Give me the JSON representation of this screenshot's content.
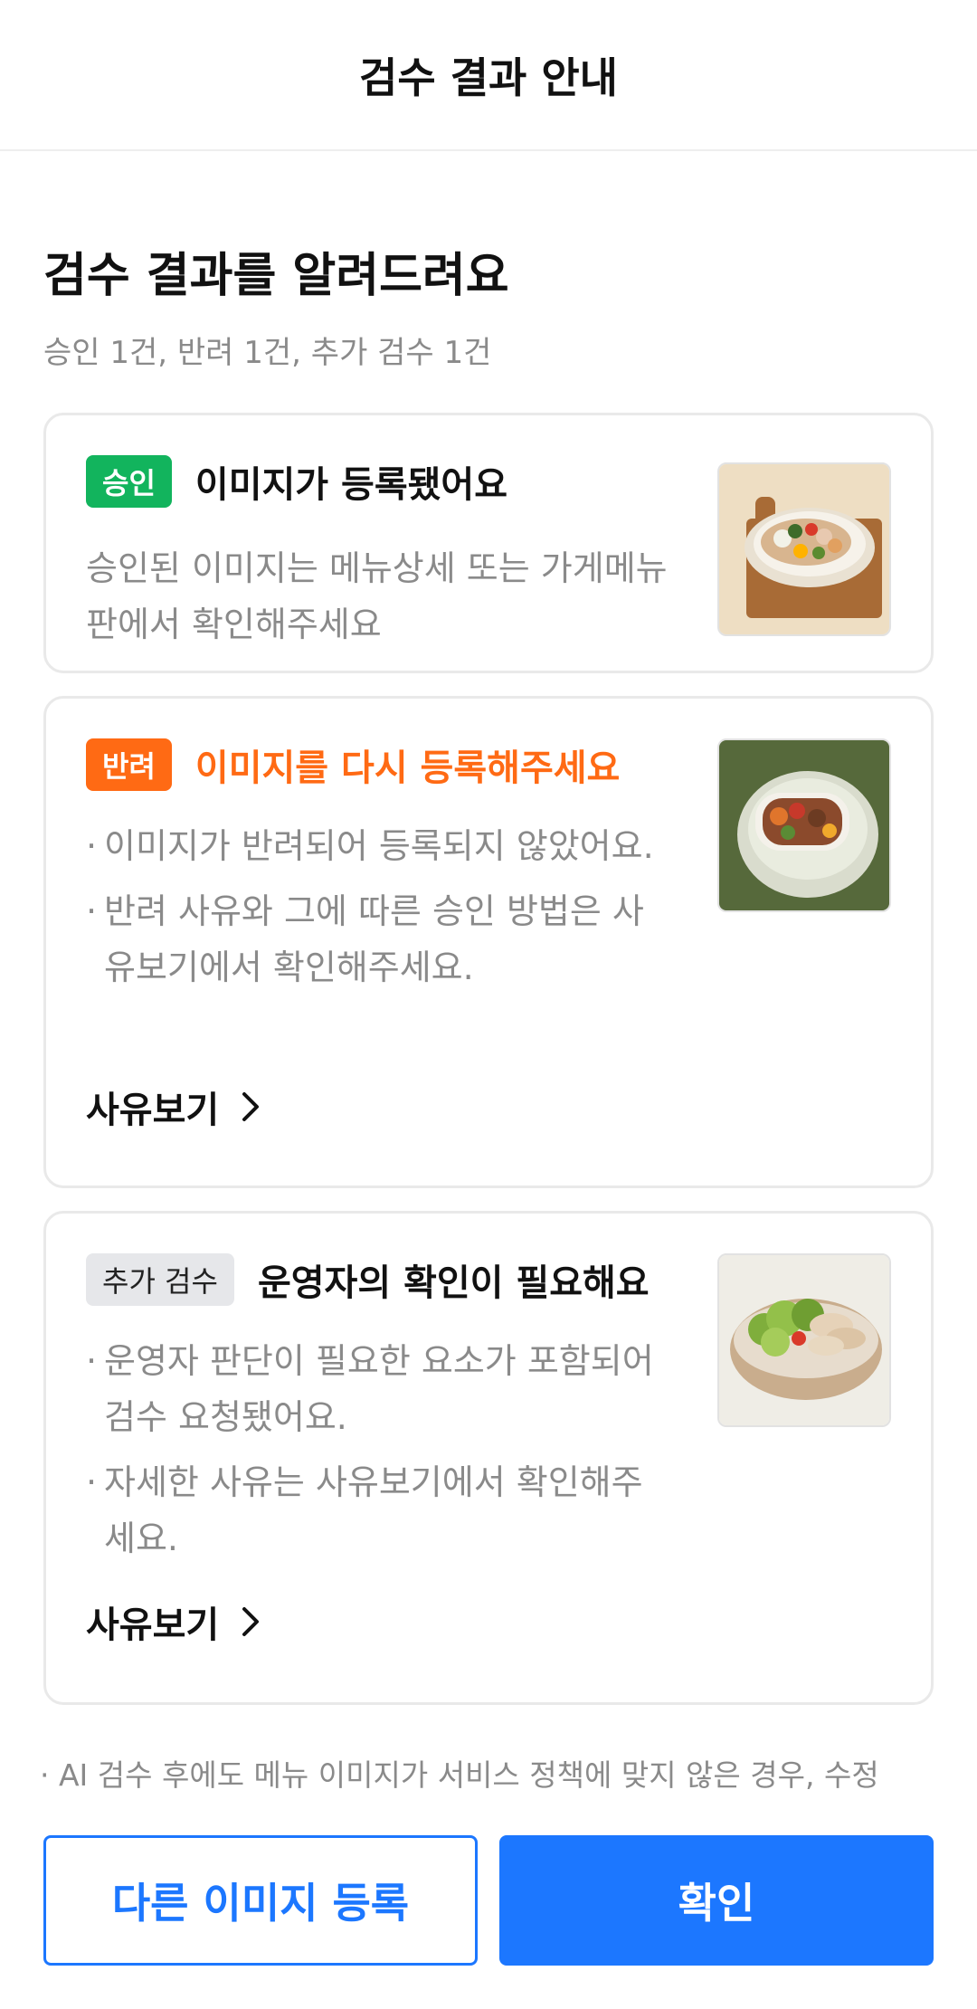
{
  "header": {
    "title": "검수 결과 안내"
  },
  "result": {
    "heading": "검수 결과를 알려드려요",
    "summary": "승인 1건, 반려 1건, 추가 검수 1건"
  },
  "cards": [
    {
      "badge": "승인",
      "title": "이미지가 등록됐어요",
      "description": "승인된 이미지는 메뉴상세 또는 가게메뉴판에서 확인해주세요",
      "thumbnail_icon": "salad-bowl-on-board-photo",
      "color": "#12b45d"
    },
    {
      "badge": "반려",
      "title": "이미지를 다시 등록해주세요",
      "bullets": [
        "이미지가 반려되어 등록되지 않았어요.",
        "반려 사유와 그에 따른 승인 방법은 사유보기에서 확인해주세요."
      ],
      "link": "사유보기",
      "thumbnail_icon": "food-plate-green-background-photo",
      "color": "#ff6a14"
    },
    {
      "badge": "추가 검수",
      "title": "운영자의 확인이 필요해요",
      "bullets": [
        "운영자 판단이 필요한 요소가 포함되어 검수 요청됐어요.",
        "자세한 사유는 사유보기에서 확인해주세요."
      ],
      "link": "사유보기",
      "thumbnail_icon": "green-salad-bowl-photo"
    }
  ],
  "notice": "AI 검수 후에도 메뉴 이미지가 서비스 정책에  맞지 않은 경우, 수정",
  "buttons": {
    "secondary": "다른 이미지 등록",
    "primary": "확인"
  },
  "colors": {
    "accent": "#1c77ff",
    "approved": "#12b45d",
    "rejected": "#ff6a14"
  }
}
